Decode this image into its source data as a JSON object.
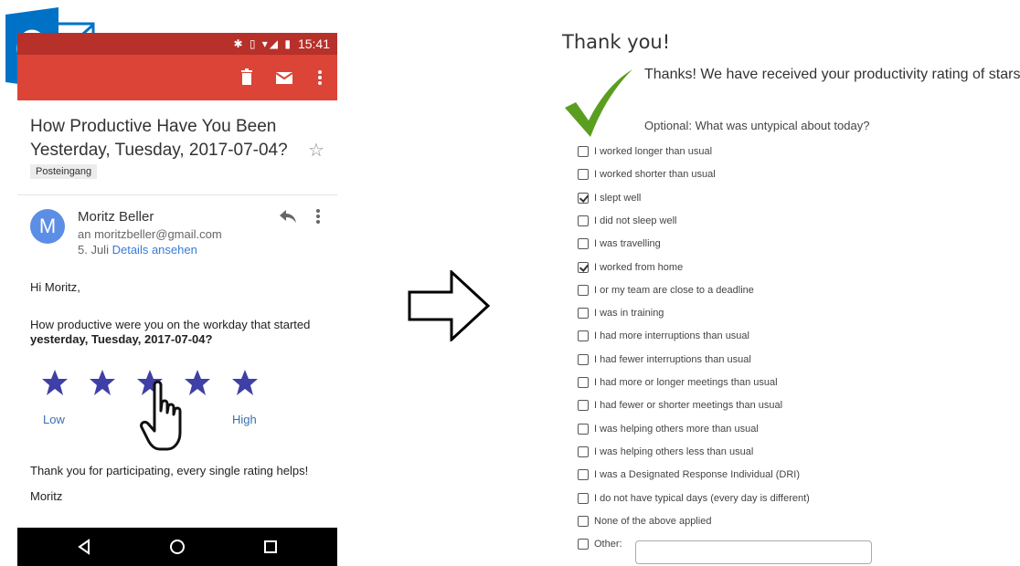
{
  "logo": {
    "name": "Outlook",
    "letter": "O",
    "brand_color": "#0072c6"
  },
  "email": {
    "status_bar": {
      "icons": "✱ ▯ ▾◢ ▮",
      "time": "15:41"
    },
    "app_bar": {
      "color": "#db4437",
      "icons": [
        "delete-icon",
        "mail-icon",
        "more-vert-icon"
      ]
    },
    "subject": "How Productive Have You Been Yesterday, Tuesday, 2017-07-04?",
    "folder_label": "Posteingang",
    "sender": {
      "avatar_letter": "M",
      "name": "Moritz Beller",
      "recipient": "an moritzbeller@gmail.com",
      "date": "5. Juli",
      "details_link": "Details ansehen"
    },
    "body": {
      "greeting": "Hi Moritz,",
      "question": "How productive were you on the workday that started",
      "question_bold": "yesterday, Tuesday, 2017-07-04?",
      "rating": {
        "max": 5,
        "low_label": "Low",
        "high_label": "High",
        "star_color": "#3f3fa6"
      },
      "thanks": "Thank you for participating, every single rating helps!",
      "signature": "Moritz"
    }
  },
  "thank_you_page": {
    "title": "Thank you!",
    "received": "Thanks! We have received your productivity rating of stars.",
    "optional_prompt": "Optional: What was untypical about today?",
    "check_color": "#5a9e1f",
    "options": [
      {
        "label": "I worked longer than usual",
        "checked": false
      },
      {
        "label": "I worked shorter than usual",
        "checked": false
      },
      {
        "label": "I slept well",
        "checked": true
      },
      {
        "label": "I did not sleep well",
        "checked": false
      },
      {
        "label": "I was travelling",
        "checked": false
      },
      {
        "label": "I worked from home",
        "checked": true
      },
      {
        "label": "I or my team are close to a deadline",
        "checked": false
      },
      {
        "label": "I was in training",
        "checked": false
      },
      {
        "label": "I had more interruptions than usual",
        "checked": false
      },
      {
        "label": "I had fewer interruptions than usual",
        "checked": false
      },
      {
        "label": "I had more or longer meetings than usual",
        "checked": false
      },
      {
        "label": "I had fewer or shorter meetings than usual",
        "checked": false
      },
      {
        "label": "I was helping others more than usual",
        "checked": false
      },
      {
        "label": "I was helping others less than usual",
        "checked": false
      },
      {
        "label": "I was a Designated Response Individual (DRI)",
        "checked": false
      },
      {
        "label": "I do not have typical days (every day is different)",
        "checked": false
      },
      {
        "label": "None of the above applied",
        "checked": false
      },
      {
        "label": "Other:",
        "checked": false
      }
    ],
    "other_value": ""
  }
}
